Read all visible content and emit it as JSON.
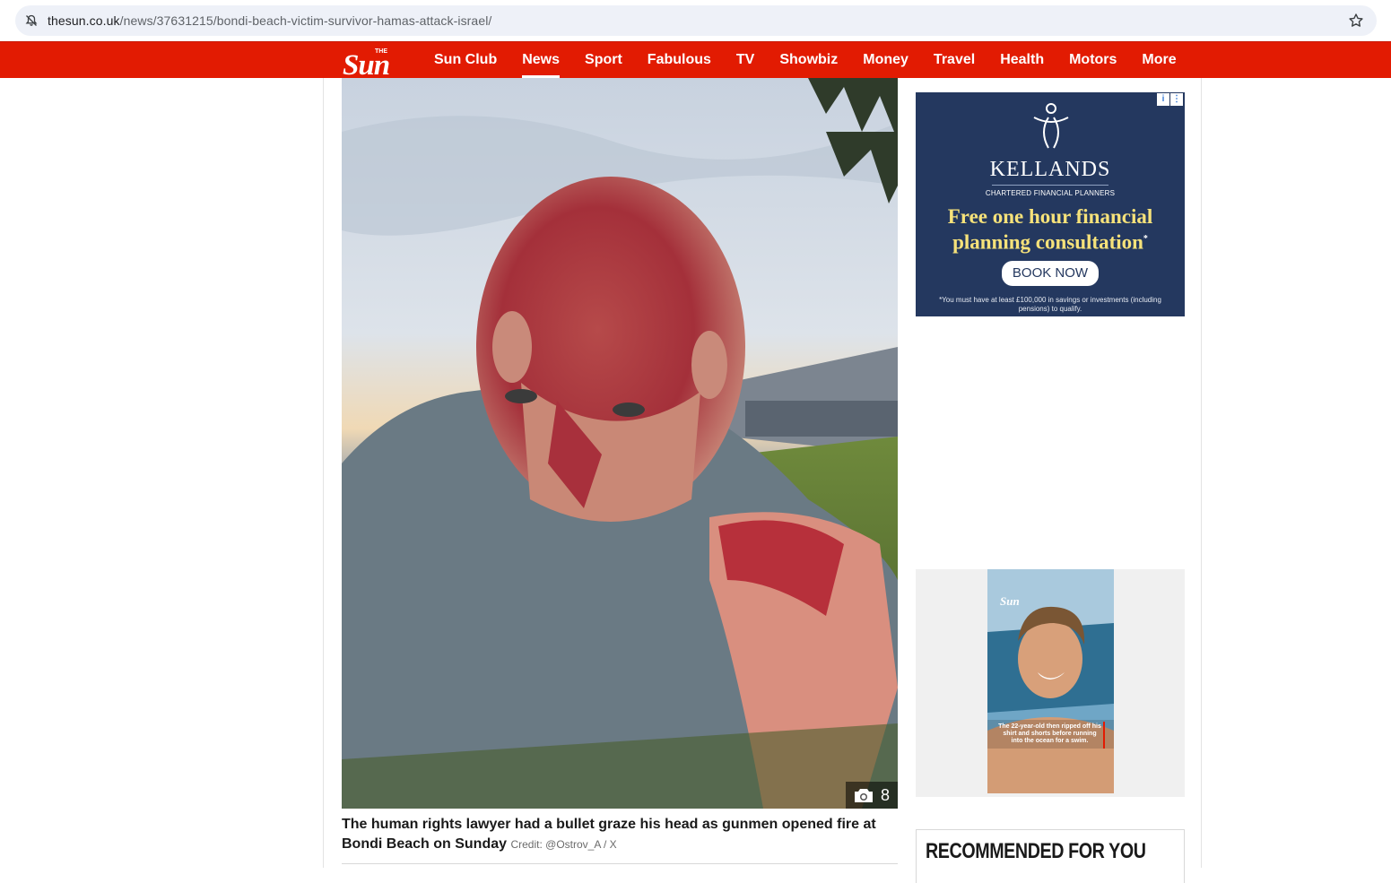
{
  "browser": {
    "url_host": "thesun.co.uk",
    "url_path": "/news/37631215/bondi-beach-victim-survivor-hamas-attack-israel/"
  },
  "nav": {
    "logo_text": "The Sun",
    "items": [
      {
        "label": "Sun Club",
        "active": false
      },
      {
        "label": "News",
        "active": true
      },
      {
        "label": "Sport",
        "active": false
      },
      {
        "label": "Fabulous",
        "active": false
      },
      {
        "label": "TV",
        "active": false
      },
      {
        "label": "Showbiz",
        "active": false
      },
      {
        "label": "Money",
        "active": false
      },
      {
        "label": "Travel",
        "active": false
      },
      {
        "label": "Health",
        "active": false
      },
      {
        "label": "Motors",
        "active": false
      },
      {
        "label": "More",
        "active": false
      }
    ]
  },
  "article": {
    "gallery_count": "8",
    "caption": "The human rights lawyer had a bullet graze his head as gunmen opened fire at Bondi Beach on Sunday",
    "credit": "Credit: @Ostrov_A / X"
  },
  "ad": {
    "brand": "KELLANDS",
    "subtitle": "CHARTERED FINANCIAL PLANNERS",
    "headline": "Free one hour financial planning consultation",
    "headline_mark": "*",
    "button": "BOOK NOW",
    "fine_print": "*You must have at least £100,000 in savings or investments (including pensions) to qualify.",
    "bg_color": "#24385f",
    "accent_color": "#f6e27a"
  },
  "video": {
    "logo": "Sun",
    "caption": "The 22-year-old then ripped off his shirt and shorts before running into the ocean for a swim."
  },
  "recommended": {
    "title": "RECOMMENDED FOR YOU"
  },
  "colors": {
    "brand_red": "#e21b02"
  }
}
